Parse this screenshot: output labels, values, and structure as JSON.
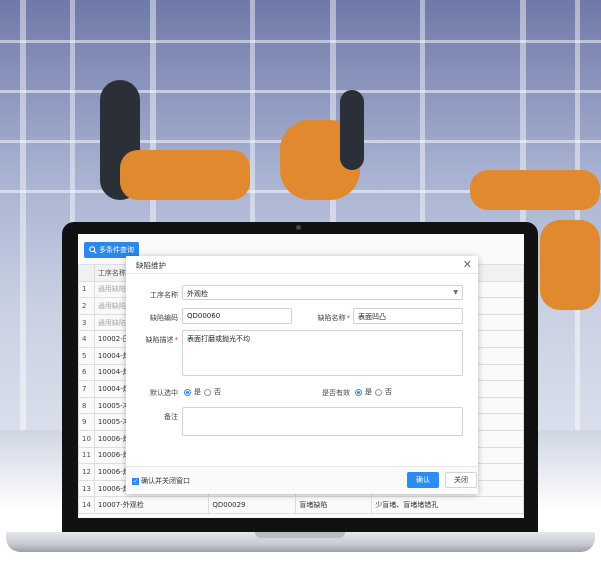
{
  "toolbar": {
    "search_label": "多条件查询"
  },
  "grid": {
    "header": [
      "",
      "工序名称"
    ],
    "rows": [
      {
        "idx": "1",
        "name": "通用缺陷",
        "muted": true
      },
      {
        "idx": "2",
        "name": "通用缺陷",
        "muted": true
      },
      {
        "idx": "3",
        "name": "通用缺陷",
        "muted": true
      },
      {
        "idx": "4",
        "name": "10002-压"
      },
      {
        "idx": "5",
        "name": "10004-焊"
      },
      {
        "idx": "6",
        "name": "10004-焊"
      },
      {
        "idx": "7",
        "name": "10004-焊"
      },
      {
        "idx": "8",
        "name": "10005-冲"
      },
      {
        "idx": "9",
        "name": "10005-冲"
      },
      {
        "idx": "10",
        "name": "10006-焊"
      },
      {
        "idx": "11",
        "name": "10006-焊"
      },
      {
        "idx": "12",
        "name": "10006-焊"
      },
      {
        "idx": "13",
        "name": "10006-焊"
      }
    ],
    "last_row": {
      "idx": "14",
      "name": "10007-外观检",
      "code": "QD00029",
      "defect": "盲堵缺陷",
      "desc": "少盲堵、盲堵堵错孔"
    }
  },
  "modal": {
    "title": "缺陷维护",
    "process_label": "工序名称",
    "process_value": "外观检",
    "code_label": "缺陷编码",
    "code_value": "QD00060",
    "name_label": "缺陷名称",
    "name_value": "表面凹凸",
    "desc_label": "缺陷描述",
    "desc_value": "表面打磨或抛光不均",
    "default_label": "默认选中",
    "valid_label": "是否有效",
    "yes": "是",
    "no": "否",
    "remark_label": "备注",
    "close_after_confirm": "确认并关闭窗口",
    "confirm": "确认",
    "close": "关闭"
  },
  "colors": {
    "primary": "#2d8cf0",
    "required": "#e33333"
  }
}
